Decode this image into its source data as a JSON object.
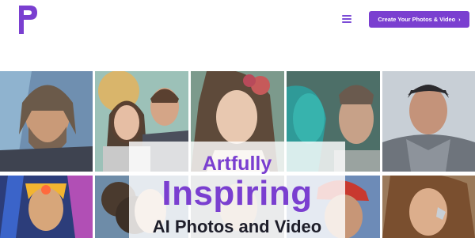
{
  "header": {
    "logo": "P",
    "menu_icon": "hamburger-menu-icon",
    "cta_label": "Create Your Photos & Video",
    "cta_arrow": "›"
  },
  "hero": {
    "line1": "Artfully",
    "line2": "Inspiring",
    "line3": "AI Photos and Video"
  },
  "gallery": {
    "tiles": [
      "ai-portrait-bearded-warrior",
      "ai-portrait-couple-suit",
      "ai-portrait-woman-flowers",
      "ai-portrait-android-and-man",
      "ai-portrait-armored-hero",
      "ai-portrait-cyber-warrior-woman",
      "ai-portrait-curly-hair-woman",
      "ai-portrait-portrait-3",
      "ai-portrait-man-cap",
      "ai-portrait-woman-circuit-face"
    ]
  },
  "colors": {
    "accent": "#7a3fd0",
    "text_dark": "#1e1e2a"
  }
}
